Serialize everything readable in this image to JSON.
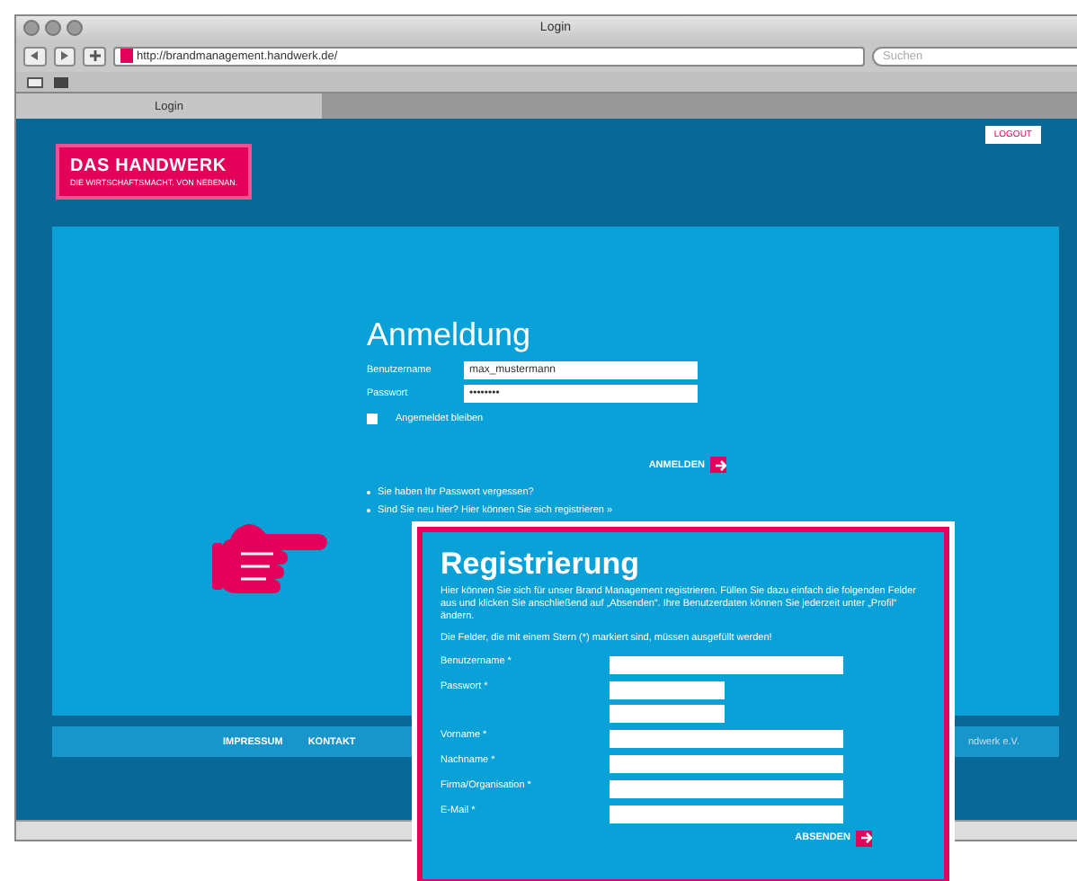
{
  "window": {
    "title": "Login"
  },
  "address_bar": {
    "url": "http://brandmanagement.handwerk.de/"
  },
  "search": {
    "placeholder": "Suchen"
  },
  "tabs": [
    {
      "label": "Login",
      "selected": true
    }
  ],
  "logo": {
    "title": "DAS HANDWERK",
    "tagline": "DIE WIRTSCHAFTSMACHT. VON NEBENAN."
  },
  "logout_button": "LOGOUT",
  "login": {
    "title": "Anmeldung",
    "fields": [
      {
        "label": "Benutzername",
        "value": "max_mustermann"
      },
      {
        "label": "Passwort",
        "value": "••••••••"
      }
    ],
    "remember": {
      "label": "Angemeldet bleiben",
      "checked": false
    },
    "submit": "ANMELDEN",
    "links": [
      "Sie haben Ihr Passwort vergessen?",
      "Sind Sie neu hier? Hier können Sie sich registrieren »"
    ]
  },
  "footer": {
    "links": [
      "IMPRESSUM",
      "KONTAKT"
    ],
    "note": "ndwerk e.V."
  },
  "registration": {
    "title": "Registrierung",
    "intro": "Hier können Sie sich für unser Brand Management registrieren. Füllen Sie dazu einfach die folgenden Felder aus und klicken Sie anschließend auf „Absenden“. Ihre Benutzerdaten können Sie jederzeit unter „Profil“ ändern.",
    "note": "Die Felder, die mit einem Stern (*) markiert sind, müssen ausgefüllt werden!",
    "fields": [
      {
        "label": "Benutzername *",
        "kind": "single"
      },
      {
        "label": "Passwort *",
        "kind": "double"
      },
      {
        "label": "Vorname *",
        "kind": "single"
      },
      {
        "label": "Nachname *",
        "kind": "single"
      },
      {
        "label": "Firma/Organisation *",
        "kind": "single"
      },
      {
        "label": "E-Mail *",
        "kind": "single"
      }
    ],
    "submit": "ABSENDEN"
  }
}
